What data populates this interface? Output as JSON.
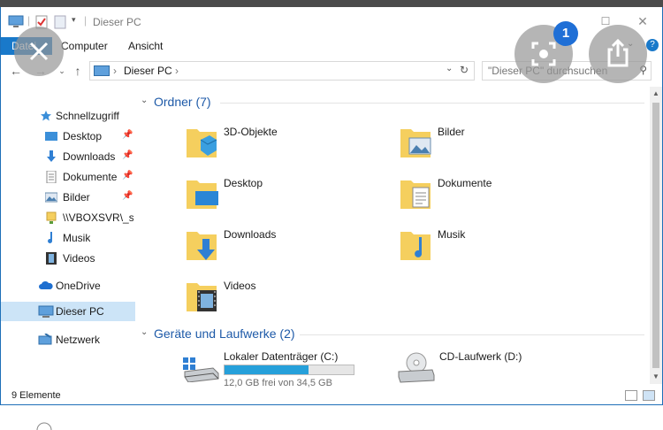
{
  "window": {
    "title": "Dieser PC",
    "ribbon_tabs": [
      "Datei",
      "Computer",
      "Ansicht"
    ]
  },
  "address": {
    "crumbs": [
      "Dieser PC"
    ],
    "search_placeholder": "\"Dieser PC\" durchsuchen"
  },
  "nav": {
    "items": [
      {
        "label": "Schnellzugriff",
        "icon": "star-icon"
      },
      {
        "label": "Desktop",
        "icon": "desktop-folder-icon",
        "pinned": true
      },
      {
        "label": "Downloads",
        "icon": "download-arrow-icon",
        "pinned": true
      },
      {
        "label": "Dokumente",
        "icon": "document-icon",
        "pinned": true
      },
      {
        "label": "Bilder",
        "icon": "picture-icon",
        "pinned": true
      },
      {
        "label": "\\\\VBOXSVR\\_sh",
        "icon": "network-share-icon"
      },
      {
        "label": "Musik",
        "icon": "music-note-icon"
      },
      {
        "label": "Videos",
        "icon": "film-icon"
      },
      {
        "label": "OneDrive",
        "icon": "cloud-icon"
      },
      {
        "label": "Dieser PC",
        "icon": "computer-icon",
        "selected": true
      },
      {
        "label": "Netzwerk",
        "icon": "network-icon"
      }
    ]
  },
  "content": {
    "folders_header": "Ordner (7)",
    "folders": [
      {
        "label": "3D-Objekte",
        "icon": "3d-objects-folder-icon"
      },
      {
        "label": "Bilder",
        "icon": "pictures-folder-icon"
      },
      {
        "label": "Desktop",
        "icon": "desktop-folder-icon"
      },
      {
        "label": "Dokumente",
        "icon": "documents-folder-icon"
      },
      {
        "label": "Downloads",
        "icon": "downloads-folder-icon"
      },
      {
        "label": "Musik",
        "icon": "music-folder-icon"
      },
      {
        "label": "Videos",
        "icon": "videos-folder-icon"
      }
    ],
    "drives_header": "Geräte und Laufwerke (2)",
    "drives": [
      {
        "label": "Lokaler Datenträger (C:)",
        "free_text": "12,0 GB frei von 34,5 GB",
        "used_fraction": 0.652,
        "icon": "hard-drive-icon"
      },
      {
        "label": "CD-Laufwerk (D:)",
        "icon": "cd-drive-icon"
      }
    ]
  },
  "status": {
    "item_count": "9 Elemente"
  },
  "overlay": {
    "badge_count": "1"
  },
  "colors": {
    "accent": "#1979ca",
    "header_blue": "#1e5aa8",
    "selected_bg": "#cce4f7",
    "drive_fill": "#26a0da",
    "folder_yellow": "#f5cf5e"
  }
}
